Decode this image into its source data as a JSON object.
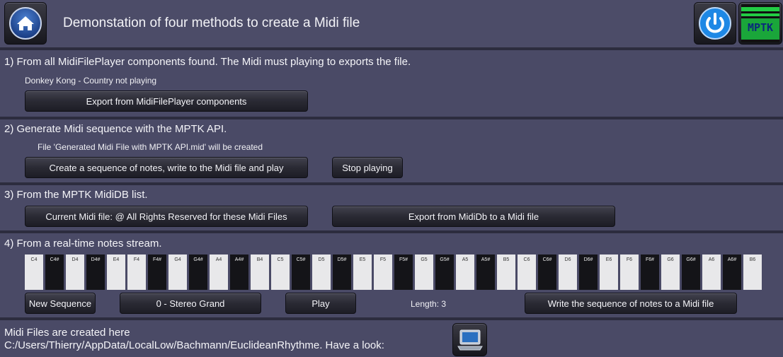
{
  "header": {
    "title": "Demonstation of four methods to create a Midi file",
    "logo_text": "MPTK"
  },
  "section1": {
    "title": "1) From all MidiFilePlayer components found. The Midi must playing to exports the file.",
    "status": "Donkey Kong - Country not playing",
    "export_button": "Export from MidiFilePlayer components"
  },
  "section2": {
    "title": "2) Generate Midi sequence with the MPTK API.",
    "info": "File 'Generated Midi File with MPTK API.mid' will be created",
    "create_button": "Create a sequence of notes, write to the Midi file and play",
    "stop_button": "Stop playing"
  },
  "section3": {
    "title": "3) From the MPTK MidiDB list.",
    "current_button": "Current Midi file: @ All Rights Reserved for these Midi Files",
    "export_button": "Export from MidiDb to a Midi file"
  },
  "section4": {
    "title": "4) From a real-time notes stream.",
    "keys": [
      "C4",
      "C4#",
      "D4",
      "D4#",
      "E4",
      "F4",
      "F4#",
      "G4",
      "G4#",
      "A4",
      "A4#",
      "B4",
      "C5",
      "C5#",
      "D5",
      "D5#",
      "E5",
      "F5",
      "F5#",
      "G5",
      "G5#",
      "A5",
      "A5#",
      "B5",
      "C6",
      "C6#",
      "D6",
      "D6#",
      "E6",
      "F6",
      "F6#",
      "G6",
      "G6#",
      "A6",
      "A6#",
      "B6"
    ],
    "new_sequence_button": "New Sequence",
    "instrument_select": "0 - Stereo Grand",
    "play_button": "Play",
    "length_label": "Length: 3",
    "write_button": "Write the sequence of notes to a Midi file"
  },
  "footer": {
    "line1": "Midi Files are created here",
    "line2": "C:/Users/Thierry/AppData/LocalLow/Bachmann/EuclideanRhythme. Have a look:"
  },
  "colors": {
    "background": "#4a4a66",
    "separator": "#2c2c3e",
    "button": "#2a2a34",
    "power_icon": "#1e88e5",
    "logo_green": "#22cc44"
  },
  "icons": {
    "home": "home-icon",
    "power": "power-icon",
    "logo": "mptk-logo-icon",
    "folder": "laptop-icon"
  }
}
